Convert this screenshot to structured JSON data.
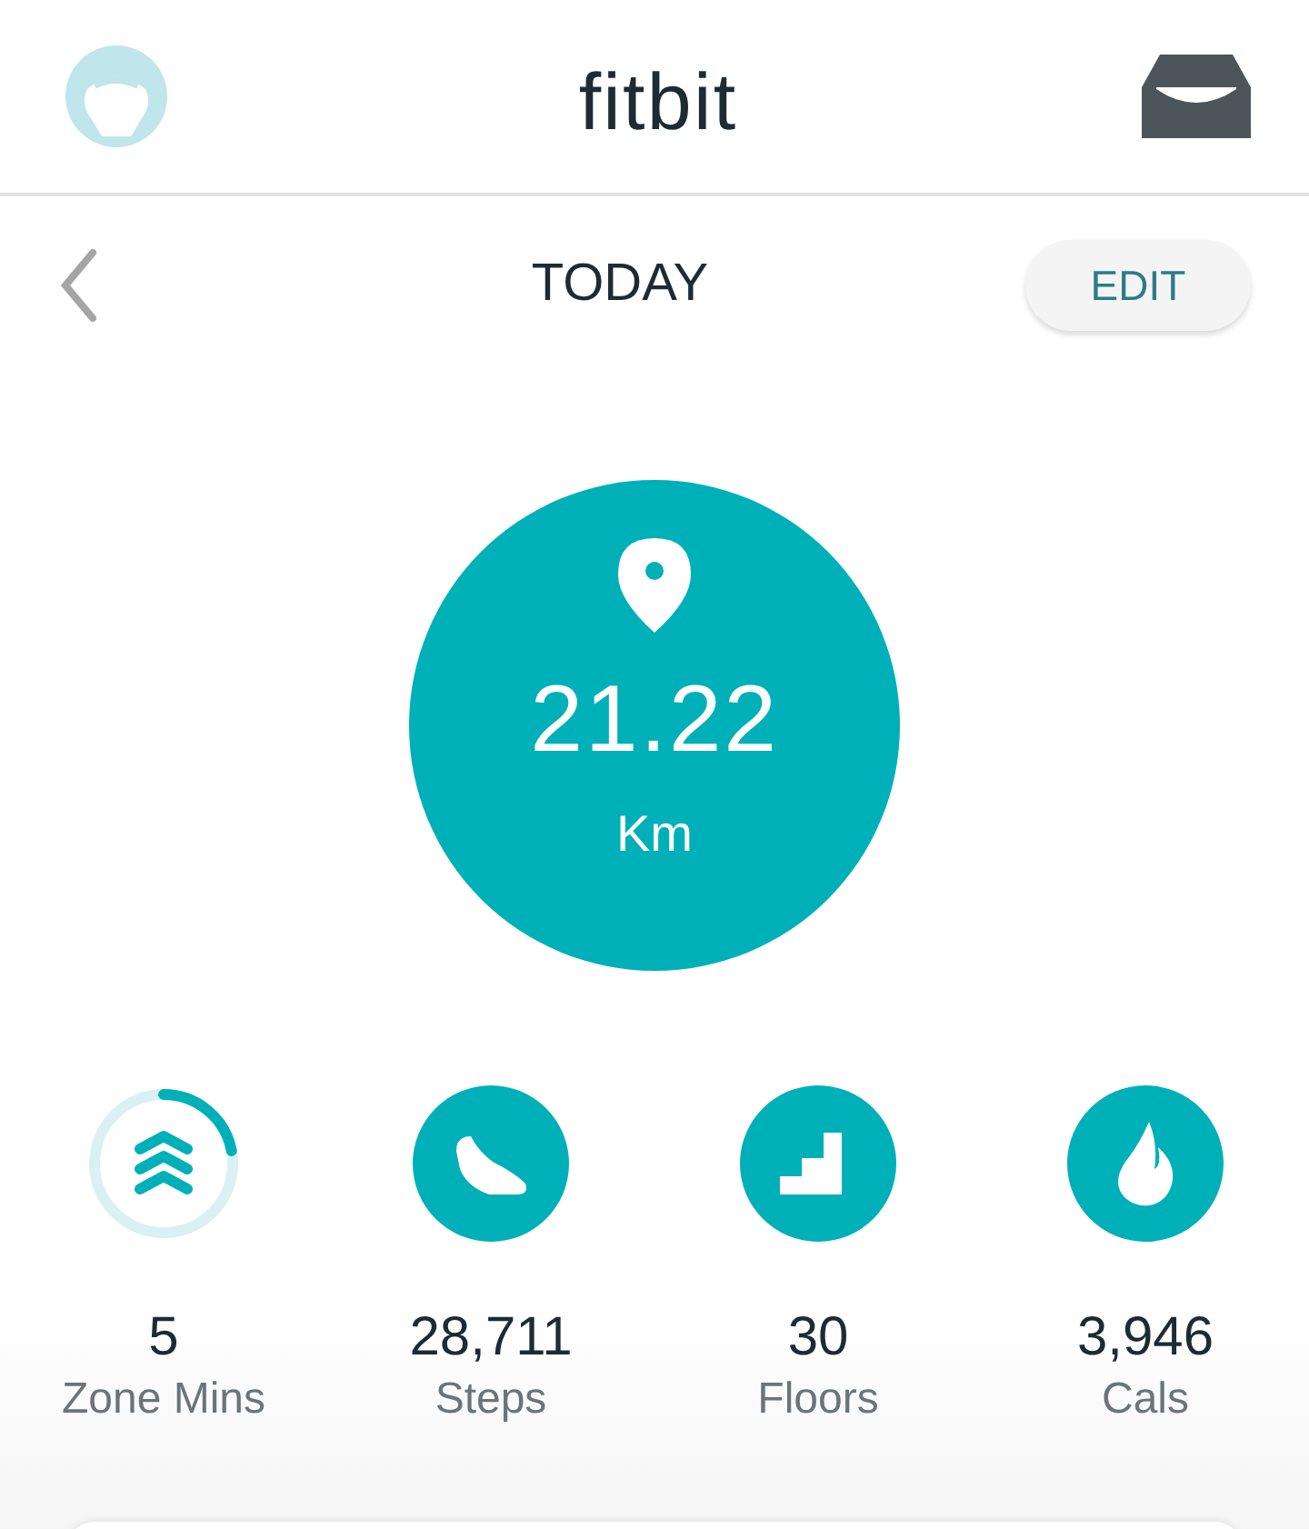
{
  "header": {
    "logo": "fitbit"
  },
  "nav": {
    "title": "TODAY",
    "edit_button": "EDIT"
  },
  "hero": {
    "value": "21.22",
    "unit": "Km"
  },
  "stats": [
    {
      "kind": "zone",
      "level": 0.22,
      "value": "5",
      "label": "Zone Mins"
    },
    {
      "kind": "steps",
      "value": "28,711",
      "label": "Steps"
    },
    {
      "kind": "floors",
      "value": "30",
      "label": "Floors"
    },
    {
      "kind": "cals",
      "value": "3,946",
      "label": "Cals"
    }
  ]
}
